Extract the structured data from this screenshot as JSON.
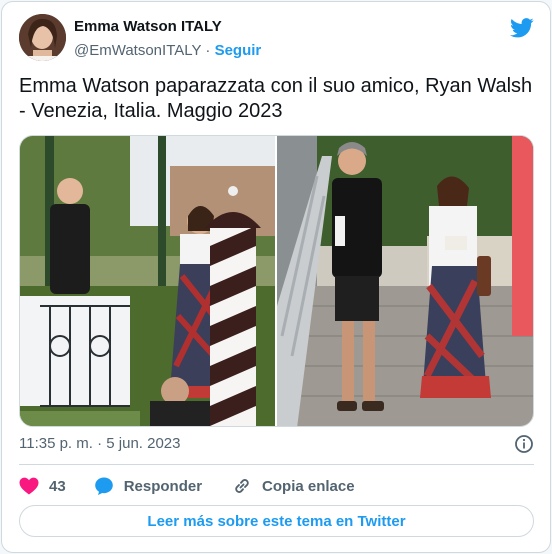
{
  "author": {
    "name": "Emma Watson ITALY",
    "handle": "@EmWatsonITALY",
    "separator": " · ",
    "follow_label": "Seguir"
  },
  "tweet": {
    "text": "Emma Watson paparazzata con il suo amico, Ryan Walsh - Venezia, Italia. Maggio 2023",
    "timestamp": "11:35 p. m. · 5 jun. 2023"
  },
  "actions": {
    "like_count": "43",
    "reply_label": "Responder",
    "copy_label": "Copia enlace"
  },
  "read_more_label": "Leer más sobre este tema en Twitter",
  "colors": {
    "accent": "#1d9bf0",
    "like": "#f91880",
    "text_secondary": "#536471",
    "border": "#cfd9de"
  },
  "icons": [
    "twitter-bird-icon",
    "info-icon",
    "heart-icon",
    "reply-bubble-icon",
    "link-icon"
  ]
}
